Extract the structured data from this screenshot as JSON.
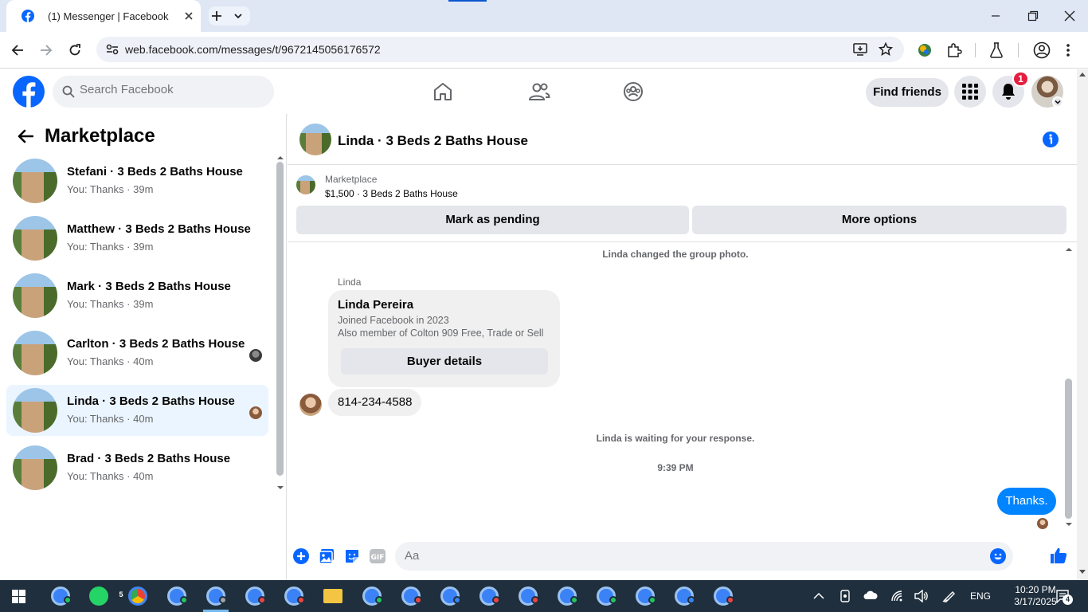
{
  "browser": {
    "tab_title": "(1) Messenger | Facebook",
    "url": "web.facebook.com/messages/t/9672145056176572"
  },
  "facebook": {
    "search_placeholder": "Search Facebook",
    "find_friends": "Find friends",
    "notification_count": "1"
  },
  "sidebar": {
    "title": "Marketplace",
    "conversations": [
      {
        "name": "Stefani · 3 Beds 2 Baths House",
        "preview": "You: Thanks · 39m",
        "seen_avatar": false,
        "active": false
      },
      {
        "name": "Matthew · 3 Beds 2 Baths House",
        "preview": "You: Thanks · 39m",
        "seen_avatar": false,
        "active": false
      },
      {
        "name": "Mark · 3 Beds 2 Baths House",
        "preview": "You: Thanks · 39m",
        "seen_avatar": false,
        "active": false
      },
      {
        "name": "Carlton · 3 Beds 2 Baths House",
        "preview": "You: Thanks · 40m",
        "seen_avatar": true,
        "active": false
      },
      {
        "name": "Linda · 3 Beds 2 Baths House",
        "preview": "You: Thanks · 40m",
        "seen_avatar": true,
        "active": true
      },
      {
        "name": "Brad · 3 Beds 2 Baths House",
        "preview": "You: Thanks · 40m",
        "seen_avatar": false,
        "active": false
      }
    ]
  },
  "conversation": {
    "title": "Linda · 3 Beds 2 Baths House",
    "listing": {
      "label": "Marketplace",
      "detail": "$1,500 · 3 Beds 2 Baths House",
      "mark_pending": "Mark as pending",
      "more_options": "More options"
    },
    "messages": {
      "system_photo": "Linda changed the group photo.",
      "sender": "Linda",
      "card_name": "Linda Pereira",
      "card_joined": "Joined Facebook in 2023",
      "card_member": "Also member of Colton 909 Free, Trade or Sell",
      "buyer_details": "Buyer details",
      "phone": "814-234-4588",
      "waiting": "Linda is waiting for your response.",
      "time": "9:39 PM",
      "outgoing": "Thanks."
    },
    "composer_placeholder": "Aa"
  },
  "taskbar": {
    "language": "ENG",
    "time": "10:20 PM",
    "date": "3/17/2025",
    "whatsapp_badge": "5",
    "notifications_badge": "4"
  },
  "colors": {
    "facebook_blue": "#0866ff",
    "messenger_blue": "#0084ff",
    "active_row": "#ebf5ff",
    "taskbar": "#1f2f3d"
  }
}
